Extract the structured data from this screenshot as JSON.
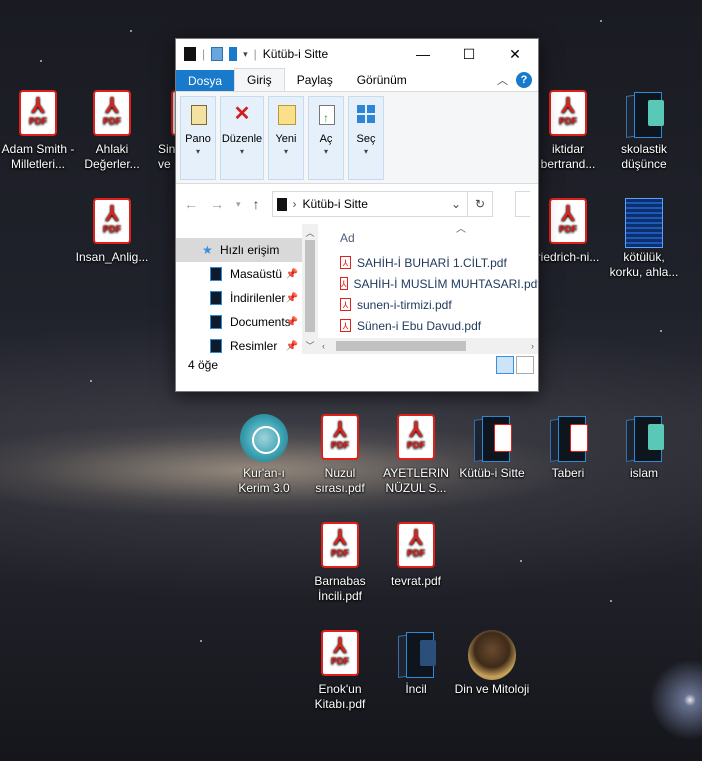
{
  "desktop": {
    "icons": [
      {
        "label": "Adam Smith - Milletleri...",
        "kind": "pdf"
      },
      {
        "label": "Ahlaki Değerler...",
        "kind": "pdf"
      },
      {
        "label": "Sin ve",
        "kind": "pdf"
      },
      {
        "label": "Insan_Anlig...",
        "kind": "pdf"
      },
      {
        "label": "iktidar bertrand...",
        "kind": "pdf"
      },
      {
        "label": "skolastik düşünce",
        "kind": "folder"
      },
      {
        "label": "riedrich-ni...",
        "kind": "pdf"
      },
      {
        "label": "kötülük, korku, ahla...",
        "kind": "book"
      },
      {
        "label": "Kur'an-ı Kerim 3.0",
        "kind": "app"
      },
      {
        "label": "Nuzul sırası.pdf",
        "kind": "pdf"
      },
      {
        "label": "AYETLERIN NÜZUL S...",
        "kind": "pdf"
      },
      {
        "label": "Kütüb-i Sitte",
        "kind": "folder"
      },
      {
        "label": "Taberi",
        "kind": "folder"
      },
      {
        "label": "islam",
        "kind": "folder"
      },
      {
        "label": "Barnabas İncili.pdf",
        "kind": "pdf"
      },
      {
        "label": "tevrat.pdf",
        "kind": "pdf"
      },
      {
        "label": "Enok'un Kitabı.pdf",
        "kind": "pdf"
      },
      {
        "label": "İncil",
        "kind": "folder"
      },
      {
        "label": "Din ve Mitoloji",
        "kind": "image"
      }
    ]
  },
  "pdf_tag": "PDF",
  "window": {
    "title": "Kütüb-i Sitte",
    "controls": {
      "minimize": "—",
      "maximize": "☐",
      "close": "✕"
    },
    "tabs": [
      "Dosya",
      "Giriş",
      "Paylaş",
      "Görünüm"
    ],
    "active_tab": "Giriş",
    "help": "?",
    "ribbon": [
      {
        "label": "Pano",
        "icon": "clipboard-icon"
      },
      {
        "label": "Düzenle",
        "icon": "delete-icon"
      },
      {
        "label": "Yeni",
        "icon": "new-folder-icon"
      },
      {
        "label": "Aç",
        "icon": "open-icon"
      },
      {
        "label": "Seç",
        "icon": "select-icon"
      }
    ],
    "address": {
      "path": "Kütüb-i Sitte"
    },
    "nav": {
      "quick_access": "Hızlı erişim",
      "items": [
        "Masaüstü",
        "İndirilenler",
        "Documents",
        "Resimler"
      ]
    },
    "column_header": "Ad",
    "files": [
      "SAHİH-İ BUHARİ 1.CİLT.pdf",
      "SAHİH-İ MUSLİM MUHTASARI.pdf",
      "sunen-i-tirmizi.pdf",
      "Sünen-i Ebu Davud.pdf"
    ],
    "status": "4 öğe"
  }
}
